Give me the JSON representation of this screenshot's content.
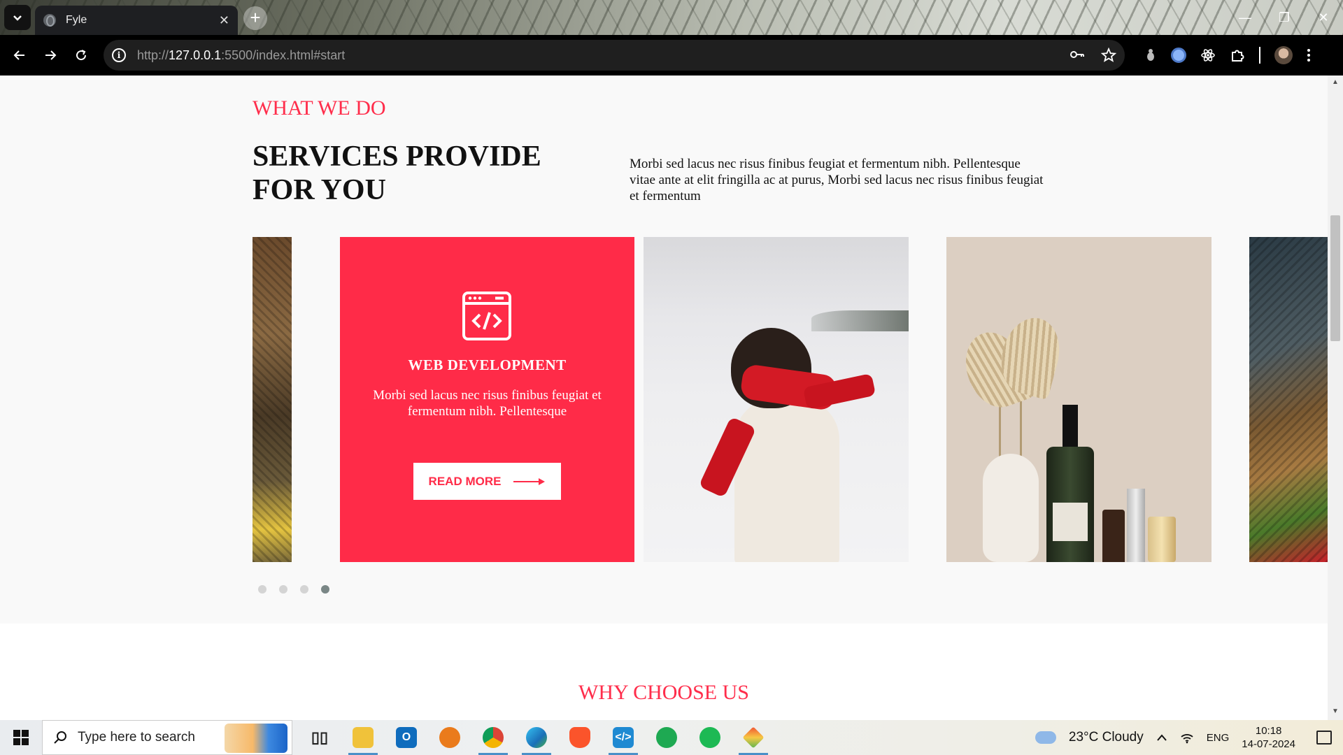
{
  "browser": {
    "tab_title": "Fyle",
    "tab_close": "✕",
    "new_tab": "+",
    "url_scheme": "http://",
    "url_host": "127.0.0.1",
    "url_rest": ":5500/index.html#start",
    "window_controls": {
      "minimize": "—",
      "restore": "❐",
      "close": "✕"
    }
  },
  "page": {
    "kicker": "WHAT WE DO",
    "heading_line1": "SERVICES PROVIDE",
    "heading_line2": "FOR YOU",
    "intro": "Morbi sed lacus nec risus finibus feugiat et fermentum nibh. Pellentesque vitae ante at elit fringilla ac at purus, Morbi sed lacus nec risus finibus feugiat et fermentum",
    "service_card": {
      "icon": "code-window-icon",
      "title": "WEB DEVELOPMENT",
      "text": "Morbi sed lacus nec risus finibus feugiat et fermentum nibh. Pellentesque",
      "button_label": "READ MORE"
    },
    "slider": {
      "slides": [
        "basket-photo",
        "service-card",
        "snow-photo",
        "product-photo",
        "basket-photo"
      ],
      "dots": 4,
      "active_dot": 4
    },
    "next_section_title": "WHY CHOOSE US",
    "accent_color": "#ff2b48"
  },
  "taskbar": {
    "search_placeholder": "Type here to search",
    "apps": [
      "task-view",
      "file-explorer",
      "outlook",
      "search-app",
      "chrome",
      "edge",
      "brave",
      "vscode",
      "whatsapp",
      "spotify",
      "git-app"
    ],
    "weather": "23°C  Cloudy",
    "language": "ENG",
    "time": "10:18",
    "date": "14-07-2024"
  }
}
